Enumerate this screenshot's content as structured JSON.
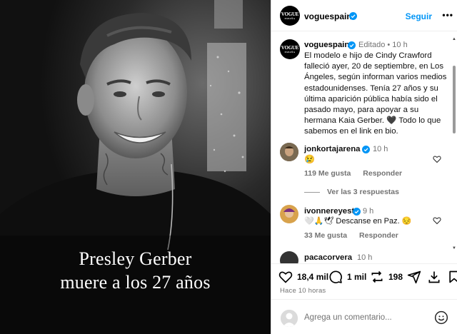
{
  "post": {
    "overlay_line1": "Presley Gerber",
    "overlay_line2": "muere a los 27 años"
  },
  "header": {
    "avatar_text": "VOGUE",
    "avatar_sub": "ESPAÑA",
    "username": "voguespain",
    "follow_label": "Seguir",
    "more_icon": "more-horizontal-icon"
  },
  "caption": {
    "username": "voguespain",
    "meta": "Editado • 10 h",
    "text": "El modelo e hijo de Cindy Crawford falleció ayer, 20 de septiembre, en Los Ángeles, según informan varios medios estadounidenses. Tenía 27 años y su última aparición pública había sido el pasado mayo, para apoyar a su hermana Kaia Gerber. 🖤 Todo lo que sabemos en el link en bio."
  },
  "comments": [
    {
      "username": "jonkortajarena",
      "time": "10 h",
      "text": "😢",
      "likes": "119 Me gusta",
      "reply_label": "Responder",
      "replies": "Ver las 3 respuestas"
    },
    {
      "username": "ivonnereyest",
      "time": "9 h",
      "text": "🤍🙏🕊 Descanse en Paz. 😔",
      "likes": "33 Me gusta",
      "reply_label": "Responder"
    },
    {
      "username": "pacacorvera",
      "time": "10 h"
    }
  ],
  "actions": {
    "likes": "18,4 mil",
    "comments": "1 mil",
    "shares": "198",
    "icons": [
      "heart-icon",
      "comment-icon",
      "share-icon",
      "save-icon"
    ]
  },
  "time_ago": "Hace 10 horas",
  "add_comment": {
    "placeholder": "Agrega un comentario...",
    "emoji_icon": "emoji-icon"
  },
  "colors": {
    "link_blue": "#0095f6",
    "verified_blue": "#0095f6",
    "muted_text": "#737373"
  }
}
